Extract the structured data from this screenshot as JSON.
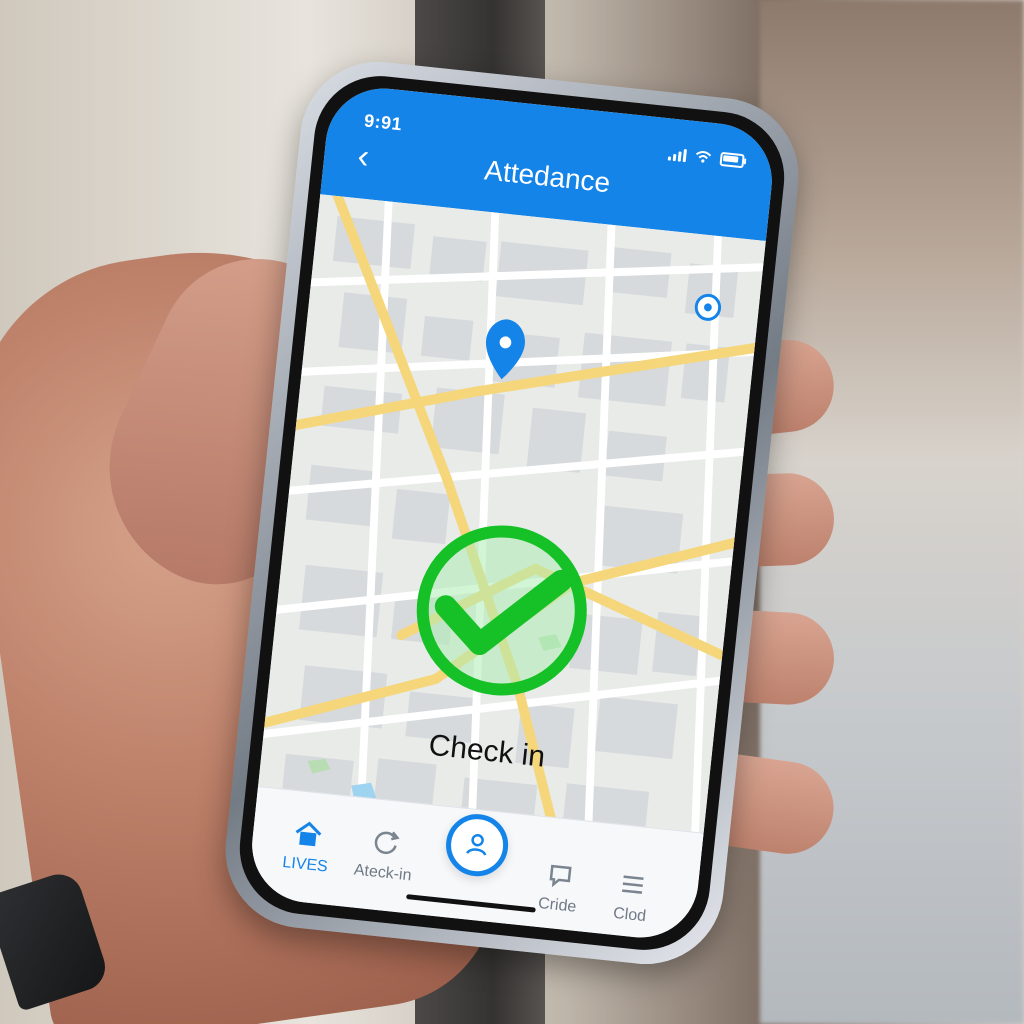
{
  "status": {
    "time": "9:91"
  },
  "header": {
    "title": "Attedance"
  },
  "main": {
    "check_label": "Check in"
  },
  "nav": {
    "items": [
      {
        "label": "LIVES",
        "icon": "home-icon",
        "active": true
      },
      {
        "label": "Ateck-in",
        "icon": "refresh-icon",
        "active": false
      },
      {
        "label": "Cride",
        "icon": "chat-icon",
        "active": false
      },
      {
        "label": "Clod",
        "icon": "menu-icon",
        "active": false
      }
    ],
    "center_icon": "profile-icon"
  },
  "colors": {
    "primary": "#1584E8",
    "success": "#16C027"
  }
}
